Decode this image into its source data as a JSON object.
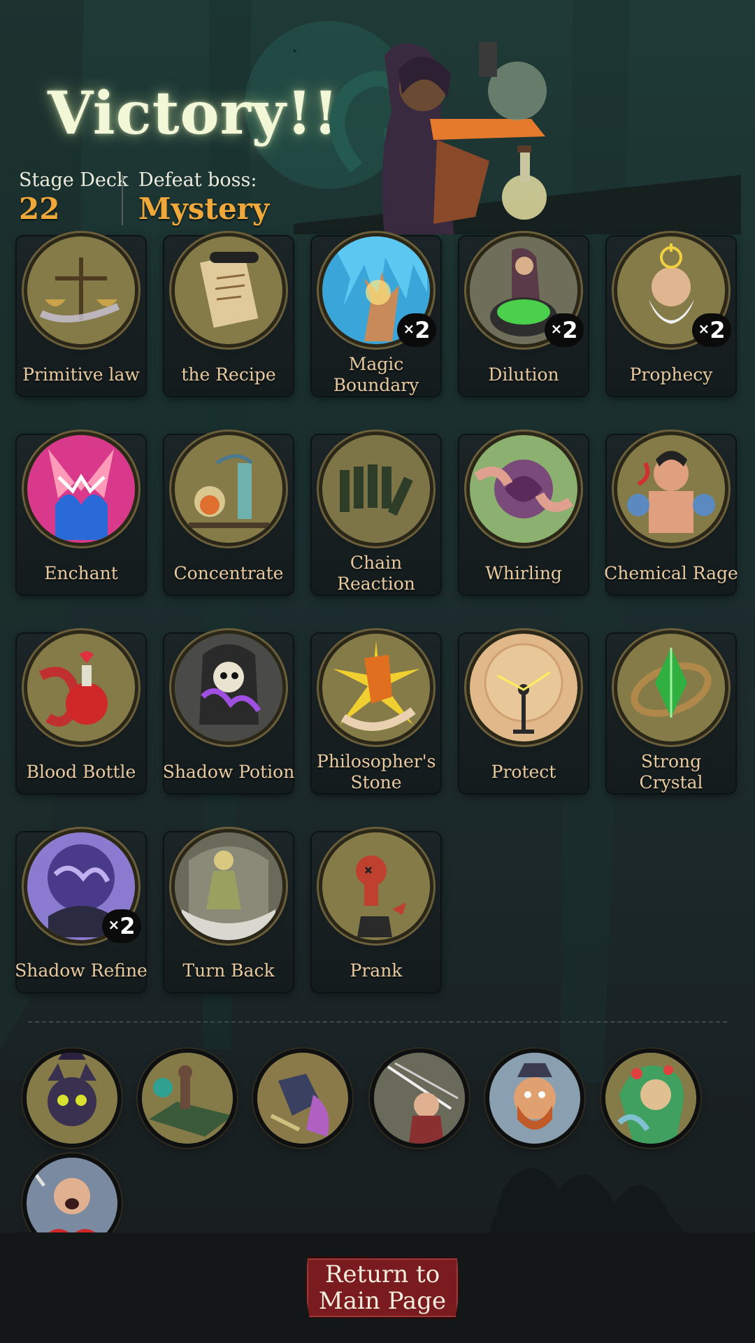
{
  "header": {
    "title": "Victory!!",
    "stage_deck_label": "Stage Deck",
    "stage_deck_value": "22",
    "defeat_boss_label": "Defeat boss:",
    "defeat_boss_value": "Mystery"
  },
  "cards": [
    {
      "name": "Primitive law",
      "icon": "scales-icon",
      "count": null
    },
    {
      "name": "the Recipe",
      "icon": "scroll-icon",
      "count": null
    },
    {
      "name": "Magic Boundary",
      "icon": "barrier-hand-icon",
      "count": "2"
    },
    {
      "name": "Dilution",
      "icon": "witch-cauldron-icon",
      "count": "2"
    },
    {
      "name": "Prophecy",
      "icon": "old-sage-icon",
      "count": "2"
    },
    {
      "name": "Enchant",
      "icon": "enchant-flame-icon",
      "count": null
    },
    {
      "name": "Concentrate",
      "icon": "alchemy-lab-icon",
      "count": null
    },
    {
      "name": "Chain Reaction",
      "icon": "dominoes-icon",
      "count": null
    },
    {
      "name": "Whirling",
      "icon": "whirl-hands-icon",
      "count": null
    },
    {
      "name": "Chemical Rage",
      "icon": "raging-brute-icon",
      "count": null
    },
    {
      "name": "Blood Bottle",
      "icon": "blood-bottle-icon",
      "count": null
    },
    {
      "name": "Shadow Potion",
      "icon": "reaper-icon",
      "count": null
    },
    {
      "name": "Philosopher's Stone",
      "icon": "stone-hand-icon",
      "count": null
    },
    {
      "name": "Protect",
      "icon": "tesla-shield-icon",
      "count": null
    },
    {
      "name": "Strong Crystal",
      "icon": "crystal-ring-icon",
      "count": null
    },
    {
      "name": "Shadow Refine",
      "icon": "shadow-orb-icon",
      "count": "2"
    },
    {
      "name": "Turn Back",
      "icon": "doll-icon",
      "count": null
    },
    {
      "name": "Prank",
      "icon": "voodoo-doll-icon",
      "count": null
    }
  ],
  "count_prefix": "×",
  "relics": [
    {
      "icon": "black-cat-witch-icon"
    },
    {
      "icon": "chess-board-icon"
    },
    {
      "icon": "knight-fight-icon"
    },
    {
      "icon": "sword-slash-girl-icon"
    },
    {
      "icon": "bearded-man-icon"
    },
    {
      "icon": "dryad-icon"
    },
    {
      "icon": "screaming-man-icon"
    }
  ],
  "footer": {
    "return_line1": "Return to",
    "return_line2": "Main Page"
  },
  "colors": {
    "accent_gold": "#f0a83a",
    "card_text": "#e8caa0",
    "button_red": "#7a1c1f"
  }
}
